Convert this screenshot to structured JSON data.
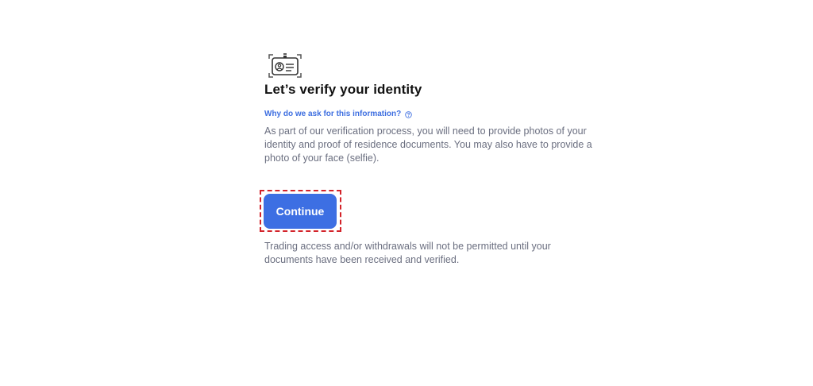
{
  "verification": {
    "icon": "id-card-icon",
    "title": "Let’s verify your identity",
    "why_link": "Why do we ask for this information?",
    "why_link_icon": "question-circle-icon",
    "description": "As part of our verification process, you will need to provide photos of your identity and proof of residence documents. You may also have to provide a photo of your face (selfie).",
    "continue_label": "Continue",
    "notice": "Trading access and/or withdrawals will not be permitted until your documents have been received and verified."
  },
  "colors": {
    "accent": "#3d6fe3",
    "link": "#3d6ee0",
    "highlight": "#d3232a",
    "body_text": "#6b6f80",
    "title_text": "#111111"
  }
}
